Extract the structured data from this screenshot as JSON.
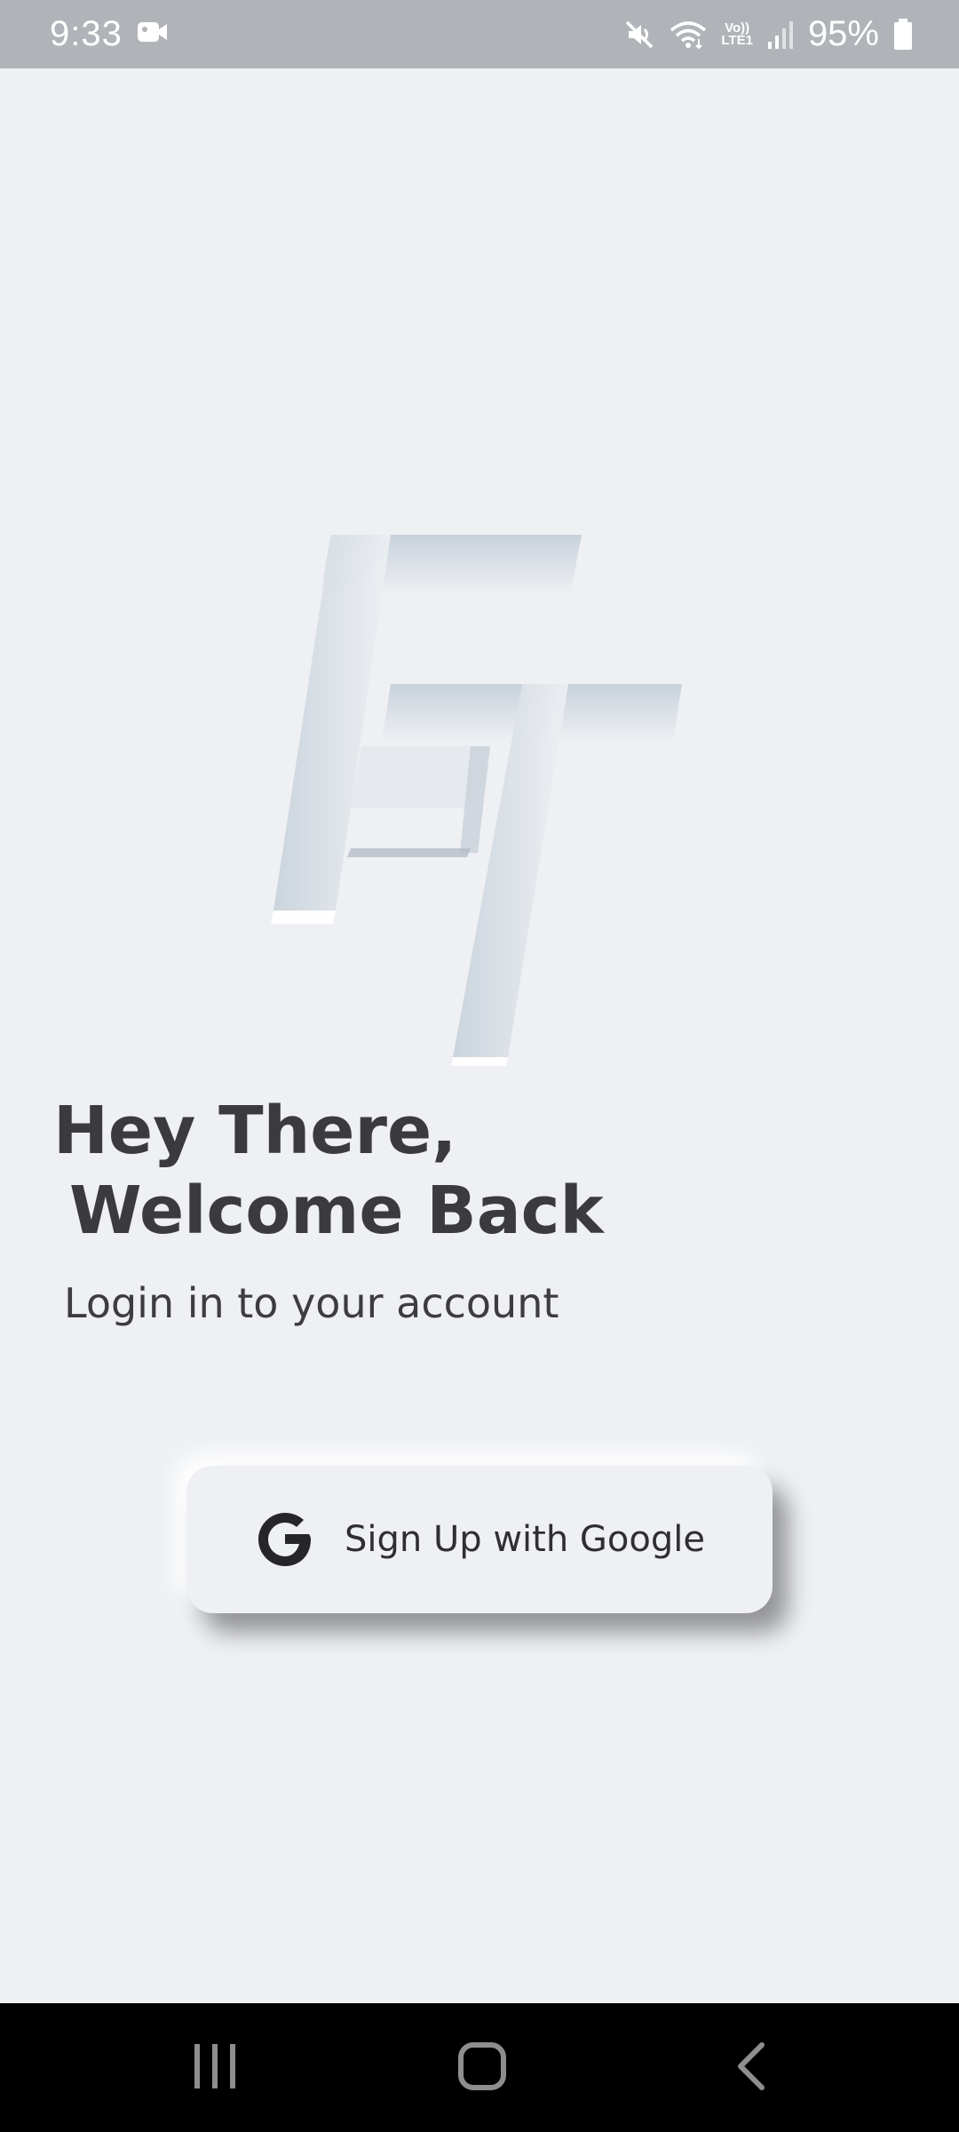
{
  "status_bar": {
    "time": "9:33",
    "battery": "95%",
    "icons": [
      "video-camera-icon",
      "mute-icon",
      "wifi-icon",
      "volte-lte-icon",
      "signal-icon",
      "battery-icon"
    ],
    "volte_text": "Vo))",
    "lte_text": "LTE1"
  },
  "logo": {
    "name": "ft-logo-icon"
  },
  "welcome": {
    "line1": "Hey There,",
    "line2": "Welcome Back",
    "subtitle": "Login in to your account"
  },
  "google_button": {
    "label": "Sign Up with Google",
    "icon": "google-g-icon"
  },
  "nav_bar": {
    "items": [
      "recents-icon",
      "home-icon",
      "back-icon"
    ]
  },
  "colors": {
    "background": "#eef0f3",
    "status_bar": "#b0b4b8",
    "text": "#3b3b3d",
    "nav_bar": "#000000"
  }
}
